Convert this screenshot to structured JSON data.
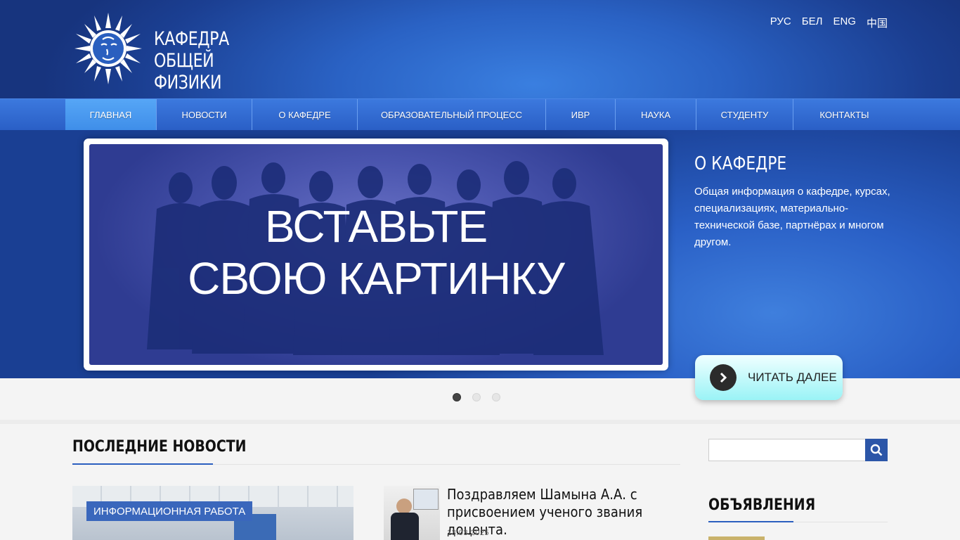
{
  "header": {
    "title_line1": "КАФЕДРА ОБЩЕЙ",
    "title_line2": "ФИЗИКИ",
    "languages": [
      "РУС",
      "БЕЛ",
      "ENG",
      "中国"
    ]
  },
  "nav": {
    "items": [
      {
        "label": "ГЛАВНАЯ",
        "active": true
      },
      {
        "label": "НОВОСТИ"
      },
      {
        "label": "О КАФЕДРЕ"
      },
      {
        "label": "ОБРАЗОВАТЕЛЬНЫЙ ПРОЦЕСС"
      },
      {
        "label": "ИВР"
      },
      {
        "label": "НАУКА"
      },
      {
        "label": "СТУДЕНТУ"
      },
      {
        "label": "КОНТАКТЫ"
      }
    ]
  },
  "slider": {
    "image_text_line1": "ВСТАВЬТЕ",
    "image_text_line2": "СВОЮ КАРТИНКУ",
    "side_title": "О КАФЕДРЕ",
    "side_text": "Общая информация о кафедре, курсах, специализациях, материально-технической базе, партнёрах и многом другом.",
    "read_more": "ЧИТАТЬ ДАЛЕЕ",
    "dots_total": 3,
    "dots_active": 1
  },
  "news": {
    "section_title": "ПОСЛЕДНИЕ НОВОСТИ",
    "featured_tag": "ИНФОРМАЦИОННАЯ РАБОТА",
    "item_title": "Поздравляем Шамына А.А. с присвоением ученого звания доцента.",
    "item_date": "13.03.2025"
  },
  "sidebar": {
    "search_placeholder": "",
    "announcements_title": "ОБЪЯВЛЕНИЯ"
  },
  "colors": {
    "brand_blue": "#2a60c6",
    "accent_line": "#2b5fbf",
    "tag_bg": "#3a67bc"
  }
}
